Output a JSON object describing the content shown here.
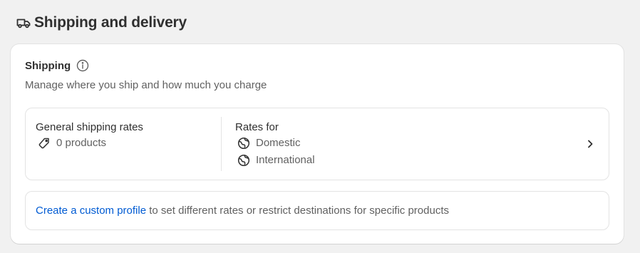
{
  "header": {
    "title": "Shipping and delivery",
    "icon": "delivery-truck-icon"
  },
  "shipping_card": {
    "title": "Shipping",
    "info_icon": "info-icon",
    "subtitle": "Manage where you ship and how much you charge",
    "general_profile": {
      "title": "General shipping rates",
      "products_text": "0 products",
      "product_icon": "tag-icon",
      "rates_heading": "Rates for",
      "zones": [
        {
          "label": "Domestic",
          "icon": "globe-icon"
        },
        {
          "label": "International",
          "icon": "globe-icon"
        }
      ],
      "chevron_icon": "chevron-right-icon"
    },
    "custom_profile": {
      "link_text": "Create a custom profile",
      "rest_text": " to set different rates or restrict destinations for specific products"
    }
  },
  "colors": {
    "page_background": "#f1f1f1",
    "card_background": "#ffffff",
    "link": "#005bd3",
    "text_primary": "#303030",
    "text_secondary": "#616161",
    "border": "#e3e3e3"
  }
}
